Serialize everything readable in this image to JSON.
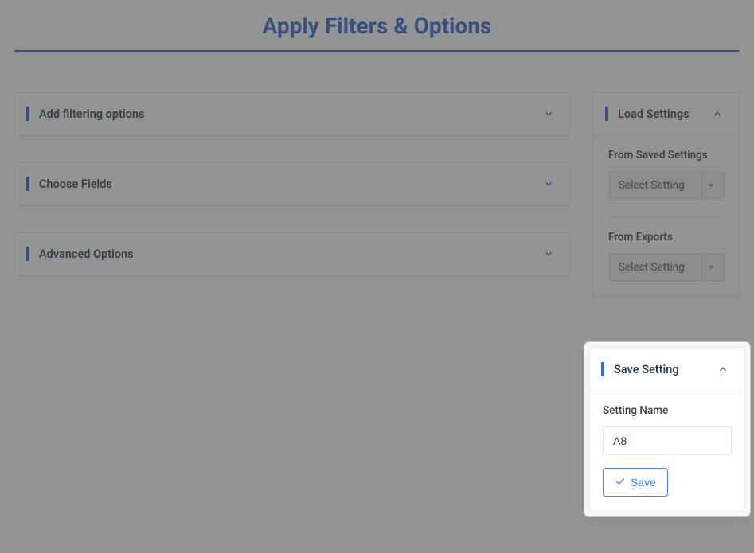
{
  "page": {
    "title": "Apply Filters & Options"
  },
  "left_panels": {
    "filtering": {
      "title": "Add filtering options"
    },
    "fields": {
      "title": "Choose Fields"
    },
    "advanced": {
      "title": "Advanced Options"
    }
  },
  "load_settings": {
    "title": "Load Settings",
    "from_saved": {
      "label": "From Saved Settings",
      "placeholder": "Select Setting"
    },
    "from_exports": {
      "label": "From Exports",
      "placeholder": "Select Setting"
    }
  },
  "save_setting": {
    "title": "Save Setting",
    "name_label": "Setting Name",
    "name_value": "A8",
    "save_label": "Save"
  }
}
